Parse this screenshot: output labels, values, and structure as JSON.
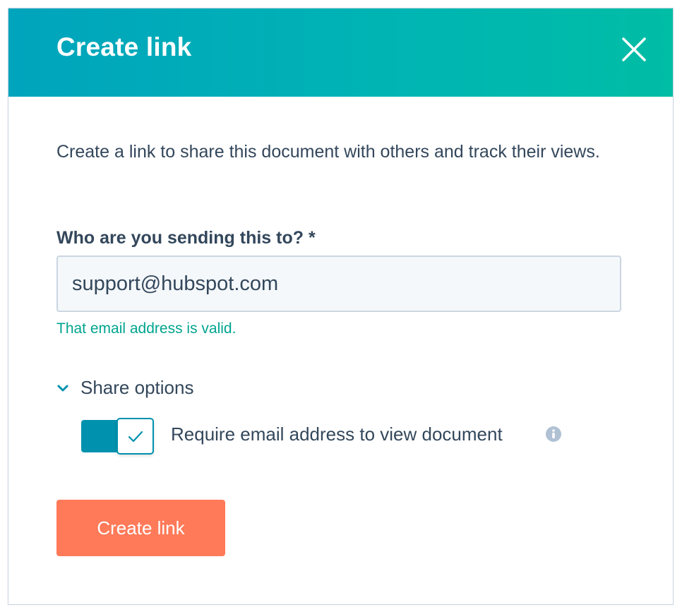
{
  "dialog": {
    "title": "Create link",
    "close_icon": "close-icon"
  },
  "body": {
    "description": "Create a link to share this document with others and track their views."
  },
  "form": {
    "recipient_label": "Who are you sending this to? *",
    "recipient_value": "support@hubspot.com",
    "validation_message": "That email address is valid."
  },
  "share_options": {
    "toggle_label": "Share options",
    "toggle_icon": "chevron-down-icon",
    "expanded": true,
    "require_email": {
      "label": "Require email address to view document",
      "enabled": true,
      "info_icon": "info-icon"
    }
  },
  "actions": {
    "create_label": "Create link"
  },
  "colors": {
    "header_start": "#00a4bd",
    "header_end": "#00bda5",
    "primary_button": "#ff7a59",
    "switch_on": "#0091ae",
    "valid_text": "#00a48f",
    "text": "#33475b"
  }
}
